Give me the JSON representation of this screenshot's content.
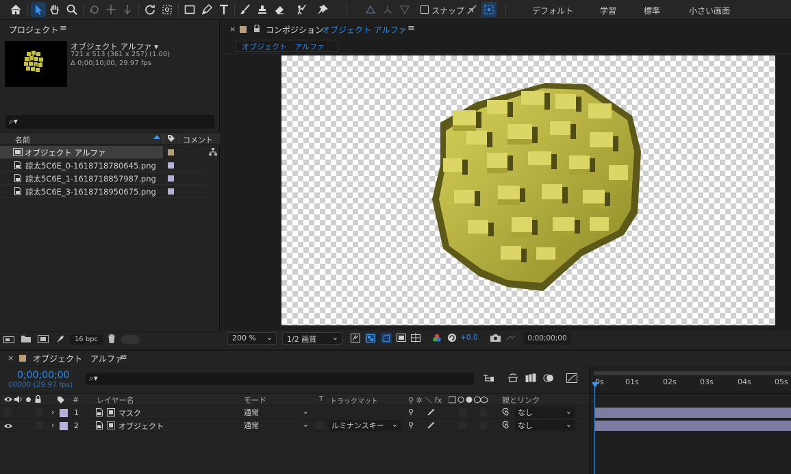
{
  "toolbar": {
    "snap_label": "スナップ",
    "workspaces": [
      "デフォルト",
      "学習",
      "標準",
      "小さい画面"
    ]
  },
  "project": {
    "title": "プロジェクト",
    "menu": "≡",
    "comp_name": "オブジェクト アルファ ▾",
    "dims": "721 x 513  (361 x 257) (1.00)",
    "duration": "Δ 0;00;10;00, 29.97 fps",
    "search_icon": "⌕▾",
    "col_name": "名前",
    "col_comment": "コメント",
    "items": [
      {
        "name": "オブジェクト アルファ",
        "icon": "composition-icon",
        "color": "#b89e79"
      },
      {
        "name": "諒太5C6E_0-1618718780645.png",
        "icon": "file-icon",
        "color": "#b4b0d8"
      },
      {
        "name": "諒太5C6E_1-1618718857987.png",
        "icon": "file-icon",
        "color": "#b4b0d8"
      },
      {
        "name": "諒太5C6E_3-1618718950675.png",
        "icon": "file-icon",
        "color": "#b4b0d8"
      }
    ],
    "bpc": "16 bpc"
  },
  "viewer": {
    "tab_prefix": "コンポジション",
    "tab_name": "オブジェクト アルファ",
    "comp_tab": "オブジェクト　アルファ",
    "zoom": "200 %",
    "quality": "1/2 画質",
    "exposure": "+0.0",
    "timecode": "0;00;00;00"
  },
  "timeline": {
    "tab_name": "オブジェクト　アルファ",
    "timecode": "0;00;00;00",
    "fps": "00000 (29.97 fps)",
    "col_hash": "#",
    "col_layer": "レイヤー名",
    "col_mode": "モード",
    "col_t": "T",
    "col_trackmatte": "トラックマット",
    "col_switches": "⚲ ✲ ＼ fx",
    "col_parent": "親とリンク",
    "ruler": [
      "0s",
      "01s",
      "02s",
      "03s",
      "04s",
      "05s"
    ],
    "layers": [
      {
        "num": "1",
        "name": "マスク",
        "mode": "通常",
        "matte": "",
        "parent": "なし",
        "color": "#b4b0d8",
        "visible": false
      },
      {
        "num": "2",
        "name": "オブジェクト",
        "mode": "通常",
        "matte": "ルミナンスキー",
        "parent": "なし",
        "color": "#b4b0d8",
        "visible": true
      }
    ]
  }
}
